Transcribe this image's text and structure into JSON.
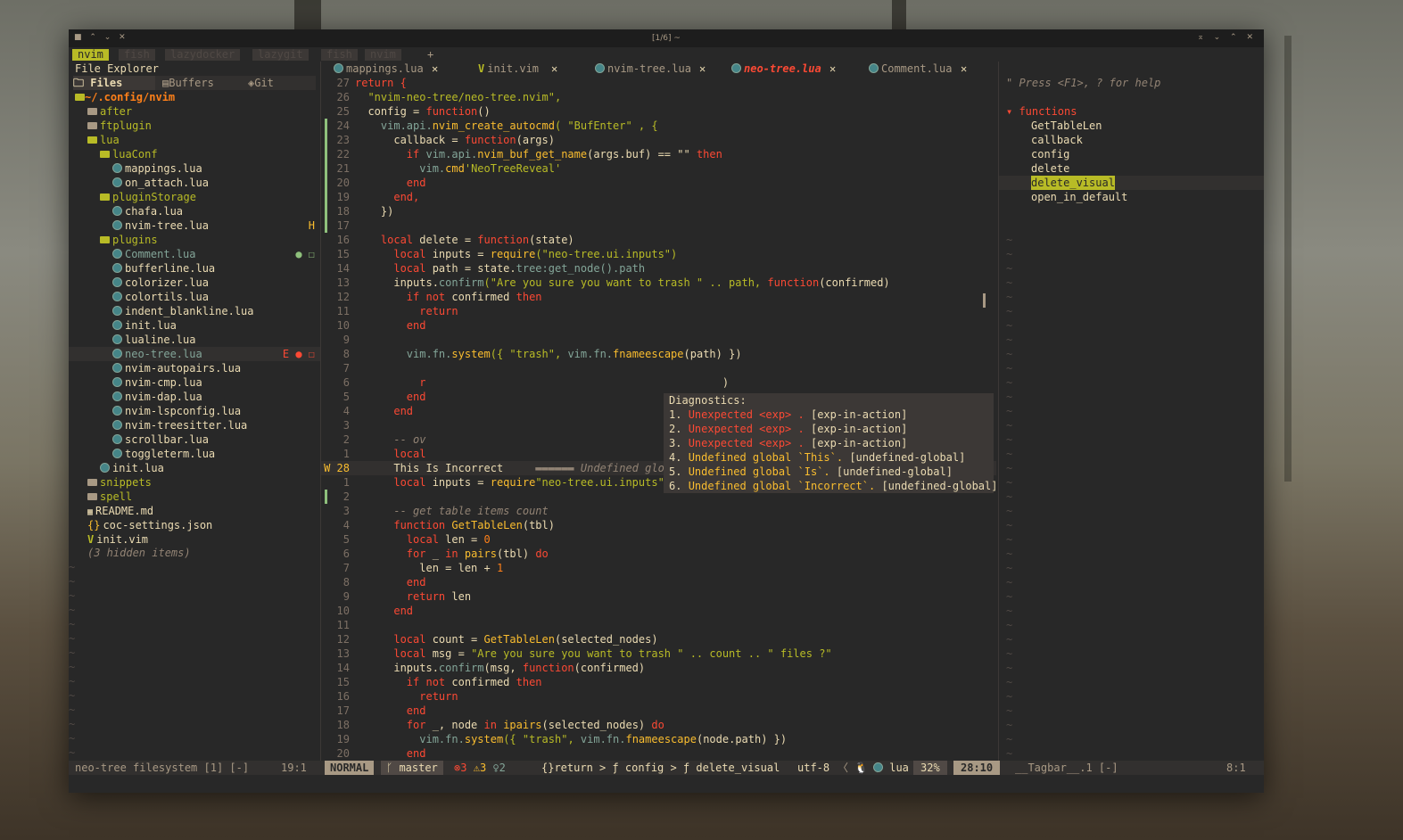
{
  "window": {
    "title": "[1/6] ~"
  },
  "terminal_tabs": [
    "nvim",
    "fish",
    "lazydocker",
    "lazygit",
    "fish",
    "nvim",
    "+"
  ],
  "left": {
    "header": "File Explorer",
    "source_tabs": [
      "Files",
      "Buffers",
      "Git"
    ],
    "root": "~/.config/nvim",
    "tree": [
      {
        "indent": 1,
        "kind": "folder",
        "name": "after"
      },
      {
        "indent": 1,
        "kind": "folder",
        "name": "ftplugin"
      },
      {
        "indent": 1,
        "kind": "folder-open",
        "name": "lua"
      },
      {
        "indent": 2,
        "kind": "folder-open",
        "name": "luaConf"
      },
      {
        "indent": 3,
        "kind": "lua",
        "name": "mappings.lua"
      },
      {
        "indent": 3,
        "kind": "lua",
        "name": "on_attach.lua"
      },
      {
        "indent": 2,
        "kind": "folder-open",
        "name": "pluginStorage"
      },
      {
        "indent": 3,
        "kind": "lua",
        "name": "chafa.lua"
      },
      {
        "indent": 3,
        "kind": "lua",
        "name": "nvim-tree.lua",
        "flag": "H"
      },
      {
        "indent": 2,
        "kind": "folder-open",
        "name": "plugins"
      },
      {
        "indent": 3,
        "kind": "lua",
        "name": "Comment.lua",
        "flag": "● ☐"
      },
      {
        "indent": 3,
        "kind": "lua",
        "name": "bufferline.lua"
      },
      {
        "indent": 3,
        "kind": "lua",
        "name": "colorizer.lua"
      },
      {
        "indent": 3,
        "kind": "lua",
        "name": "colortils.lua"
      },
      {
        "indent": 3,
        "kind": "lua",
        "name": "indent_blankline.lua"
      },
      {
        "indent": 3,
        "kind": "lua",
        "name": "init.lua"
      },
      {
        "indent": 3,
        "kind": "lua",
        "name": "lualine.lua"
      },
      {
        "indent": 3,
        "kind": "lua",
        "name": "neo-tree.lua",
        "flag": "E ● ☐"
      },
      {
        "indent": 3,
        "kind": "lua",
        "name": "nvim-autopairs.lua"
      },
      {
        "indent": 3,
        "kind": "lua",
        "name": "nvim-cmp.lua"
      },
      {
        "indent": 3,
        "kind": "lua",
        "name": "nvim-dap.lua"
      },
      {
        "indent": 3,
        "kind": "lua",
        "name": "nvim-lspconfig.lua"
      },
      {
        "indent": 3,
        "kind": "lua",
        "name": "nvim-treesitter.lua"
      },
      {
        "indent": 3,
        "kind": "lua",
        "name": "scrollbar.lua"
      },
      {
        "indent": 3,
        "kind": "lua",
        "name": "toggleterm.lua"
      },
      {
        "indent": 2,
        "kind": "lua",
        "name": "init.lua"
      },
      {
        "indent": 1,
        "kind": "folder",
        "name": "snippets"
      },
      {
        "indent": 1,
        "kind": "folder",
        "name": "spell"
      },
      {
        "indent": 1,
        "kind": "md",
        "name": "README.md"
      },
      {
        "indent": 1,
        "kind": "json",
        "name": "coc-settings.json"
      },
      {
        "indent": 1,
        "kind": "vim",
        "name": "init.vim"
      }
    ],
    "hidden": "(3 hidden items)",
    "status": "neo-tree filesystem [1] [-]",
    "status_pos": "19:1"
  },
  "buffers": [
    {
      "name": "mappings.lua",
      "icon": "lua"
    },
    {
      "name": "init.vim",
      "icon": "vim"
    },
    {
      "name": "nvim-tree.lua",
      "icon": "lua"
    },
    {
      "name": "neo-tree.lua",
      "icon": "lua",
      "active": true
    },
    {
      "name": "Comment.lua",
      "icon": "lua"
    }
  ],
  "code": [
    {
      "n": "27",
      "t": [
        [
          "return {",
          "kw"
        ]
      ]
    },
    {
      "n": "26",
      "t": [
        [
          "  \"nvim-neo-tree/neo-tree.nvim\",",
          "str"
        ]
      ]
    },
    {
      "n": "25",
      "t": [
        [
          "  config = ",
          "yl"
        ],
        [
          "function",
          "kw"
        ],
        [
          "()",
          "yl"
        ]
      ]
    },
    {
      "n": "24",
      "t": [
        [
          "    vim.api.",
          "id"
        ],
        [
          "nvim_create_autocmd",
          "fn"
        ],
        [
          "( \"BufEnter\" , {",
          "str"
        ]
      ]
    },
    {
      "n": "23",
      "t": [
        [
          "      callback = ",
          "yl"
        ],
        [
          "function",
          "kw"
        ],
        [
          "(args)",
          "yl"
        ]
      ]
    },
    {
      "n": "22",
      "t": [
        [
          "        if ",
          "kw"
        ],
        [
          "vim.api.",
          "id"
        ],
        [
          "nvim_buf_get_name",
          "fn"
        ],
        [
          "(args.buf) == \"\" ",
          "yl"
        ],
        [
          "then",
          "kw"
        ]
      ]
    },
    {
      "n": "21",
      "t": [
        [
          "          vim.",
          "id"
        ],
        [
          "cmd",
          "fn"
        ],
        [
          "'NeoTreeReveal'",
          "str"
        ]
      ]
    },
    {
      "n": "20",
      "t": [
        [
          "        end",
          "kw"
        ]
      ]
    },
    {
      "n": "19",
      "t": [
        [
          "      end,",
          "kw"
        ]
      ]
    },
    {
      "n": "18",
      "t": [
        [
          "    })",
          "yl"
        ]
      ]
    },
    {
      "n": "17",
      "t": [
        [
          "",
          "yl"
        ]
      ]
    },
    {
      "n": "16",
      "t": [
        [
          "    local ",
          "kw"
        ],
        [
          "delete = ",
          "yl"
        ],
        [
          "function",
          "kw"
        ],
        [
          "(state)",
          "yl"
        ]
      ]
    },
    {
      "n": "15",
      "t": [
        [
          "      local ",
          "kw"
        ],
        [
          "inputs = ",
          "yl"
        ],
        [
          "require",
          "fn"
        ],
        [
          "(\"neo-tree.ui.inputs\")",
          "str"
        ]
      ]
    },
    {
      "n": "14",
      "t": [
        [
          "      local ",
          "kw"
        ],
        [
          "path = state.",
          "yl"
        ],
        [
          "tree:get_node().path",
          "id"
        ]
      ]
    },
    {
      "n": "13",
      "t": [
        [
          "      inputs.",
          "yl"
        ],
        [
          "confirm",
          "id"
        ],
        [
          "(\"Are you sure you want to trash \" .. path, ",
          "str"
        ],
        [
          "function",
          "kw"
        ],
        [
          "(confirmed)",
          "yl"
        ]
      ]
    },
    {
      "n": "12",
      "t": [
        [
          "        if not ",
          "kw"
        ],
        [
          "confirmed ",
          "yl"
        ],
        [
          "then",
          "kw"
        ]
      ]
    },
    {
      "n": "11",
      "t": [
        [
          "          return",
          "kw"
        ]
      ]
    },
    {
      "n": "10",
      "t": [
        [
          "        end",
          "kw"
        ]
      ]
    },
    {
      "n": "9",
      "t": [
        [
          "",
          "yl"
        ]
      ]
    },
    {
      "n": "8",
      "t": [
        [
          "        vim.",
          "id"
        ],
        [
          "fn.",
          "id"
        ],
        [
          "system",
          "fn"
        ],
        [
          "({ \"trash\", ",
          "str"
        ],
        [
          "vim.fn.",
          "id"
        ],
        [
          "fnameescape",
          "fn"
        ],
        [
          "(path) })",
          "yl"
        ]
      ]
    },
    {
      "n": "7",
      "t": [
        [
          "          ",
          "yl"
        ]
      ]
    },
    {
      "n": "6",
      "t": [
        [
          "          r",
          "kw"
        ],
        [
          "                                              )",
          "yl"
        ]
      ]
    },
    {
      "n": "5",
      "t": [
        [
          "        end",
          "kw"
        ]
      ]
    },
    {
      "n": "4",
      "t": [
        [
          "      end",
          "kw"
        ]
      ]
    },
    {
      "n": "3",
      "t": [
        [
          "",
          "yl"
        ]
      ]
    },
    {
      "n": "2",
      "t": [
        [
          "      -- ov",
          "cm"
        ],
        [
          "                                              n.",
          "cm"
        ]
      ]
    },
    {
      "n": "1",
      "t": [
        [
          "      local",
          "kw"
        ]
      ]
    },
    {
      "n": "W 28",
      "cur": true,
      "t": [
        [
          "      This Is Incorrect",
          "yl"
        ],
        [
          "     ▬▬▬▬▬▬ Undefined global `Incorrect`.",
          "cm"
        ]
      ]
    },
    {
      "n": "1",
      "t": [
        [
          "      local ",
          "kw"
        ],
        [
          "inputs = ",
          "yl"
        ],
        [
          "require",
          "fn"
        ],
        [
          "\"neo-tree.ui.inputs\"",
          "str"
        ]
      ]
    },
    {
      "n": "2",
      "t": [
        [
          "",
          "yl"
        ]
      ]
    },
    {
      "n": "3",
      "t": [
        [
          "      -- get table items count",
          "cm"
        ]
      ]
    },
    {
      "n": "4",
      "t": [
        [
          "      function ",
          "kw"
        ],
        [
          "GetTableLen",
          "fn"
        ],
        [
          "(tbl)",
          "yl"
        ]
      ]
    },
    {
      "n": "5",
      "t": [
        [
          "        local ",
          "kw"
        ],
        [
          "len = ",
          "yl"
        ],
        [
          "0",
          "op"
        ]
      ]
    },
    {
      "n": "6",
      "t": [
        [
          "        for ",
          "kw"
        ],
        [
          "_ ",
          "yl"
        ],
        [
          "in ",
          "kw"
        ],
        [
          "pairs",
          "fn"
        ],
        [
          "(tbl) ",
          "yl"
        ],
        [
          "do",
          "kw"
        ]
      ]
    },
    {
      "n": "7",
      "t": [
        [
          "          len = len + ",
          "yl"
        ],
        [
          "1",
          "op"
        ]
      ]
    },
    {
      "n": "8",
      "t": [
        [
          "        end",
          "kw"
        ]
      ]
    },
    {
      "n": "9",
      "t": [
        [
          "        return ",
          "kw"
        ],
        [
          "len",
          "yl"
        ]
      ]
    },
    {
      "n": "10",
      "t": [
        [
          "      end",
          "kw"
        ]
      ]
    },
    {
      "n": "11",
      "t": [
        [
          "",
          "yl"
        ]
      ]
    },
    {
      "n": "12",
      "t": [
        [
          "      local ",
          "kw"
        ],
        [
          "count = ",
          "yl"
        ],
        [
          "GetTableLen",
          "fn"
        ],
        [
          "(selected_nodes)",
          "yl"
        ]
      ]
    },
    {
      "n": "13",
      "t": [
        [
          "      local ",
          "kw"
        ],
        [
          "msg = ",
          "yl"
        ],
        [
          "\"Are you sure you want to trash \" .. count .. \" files ?\"",
          "str"
        ]
      ]
    },
    {
      "n": "14",
      "t": [
        [
          "      inputs.",
          "yl"
        ],
        [
          "confirm",
          "id"
        ],
        [
          "(msg, ",
          "yl"
        ],
        [
          "function",
          "kw"
        ],
        [
          "(confirmed)",
          "yl"
        ]
      ]
    },
    {
      "n": "15",
      "t": [
        [
          "        if not ",
          "kw"
        ],
        [
          "confirmed ",
          "yl"
        ],
        [
          "then",
          "kw"
        ]
      ]
    },
    {
      "n": "16",
      "t": [
        [
          "          return",
          "kw"
        ]
      ]
    },
    {
      "n": "17",
      "t": [
        [
          "        end",
          "kw"
        ]
      ]
    },
    {
      "n": "18",
      "t": [
        [
          "        for ",
          "kw"
        ],
        [
          "_, node ",
          "yl"
        ],
        [
          "in ",
          "kw"
        ],
        [
          "ipairs",
          "fn"
        ],
        [
          "(selected_nodes) ",
          "yl"
        ],
        [
          "do",
          "kw"
        ]
      ]
    },
    {
      "n": "19",
      "t": [
        [
          "          vim.",
          "id"
        ],
        [
          "fn.",
          "id"
        ],
        [
          "system",
          "fn"
        ],
        [
          "({ \"trash\", ",
          "str"
        ],
        [
          "vim.fn.",
          "id"
        ],
        [
          "fnameescape",
          "fn"
        ],
        [
          "(node.path) })",
          "yl"
        ]
      ]
    },
    {
      "n": "20",
      "t": [
        [
          "        end",
          "kw"
        ]
      ]
    }
  ],
  "diagnostics": {
    "title": "Diagnostics:",
    "items": [
      {
        "num": "1.",
        "msg": "Unexpected <exp> .",
        "code": "[exp-in-action]"
      },
      {
        "num": "2.",
        "msg": "Unexpected <exp> .",
        "code": "[exp-in-action]"
      },
      {
        "num": "3.",
        "msg": "Unexpected <exp> .",
        "code": "[exp-in-action]"
      },
      {
        "num": "4.",
        "msg": "Undefined global `This`.",
        "code": "[undefined-global]"
      },
      {
        "num": "5.",
        "msg": "Undefined global `Is`.",
        "code": "[undefined-global]"
      },
      {
        "num": "6.",
        "msg": "Undefined global `Incorrect`.",
        "code": "[undefined-global]"
      }
    ]
  },
  "statusline": {
    "mode": "NORMAL",
    "branch": "master",
    "errors": "3",
    "warnings": "3",
    "hints": "2",
    "breadcrumb": "{}return > ƒ config > ƒ delete_visual",
    "encoding": "utf-8",
    "filetype": "lua",
    "percent": "32%",
    "position": "28:10"
  },
  "tagbar": {
    "help": "\" Press <F1>, ? for help",
    "group": "functions",
    "items": [
      "GetTableLen",
      "callback",
      "config",
      "delete",
      "delete_visual",
      "open_in_default"
    ],
    "selected": "delete_visual",
    "status": "__Tagbar__.1 [-]",
    "status_pos": "8:1"
  }
}
